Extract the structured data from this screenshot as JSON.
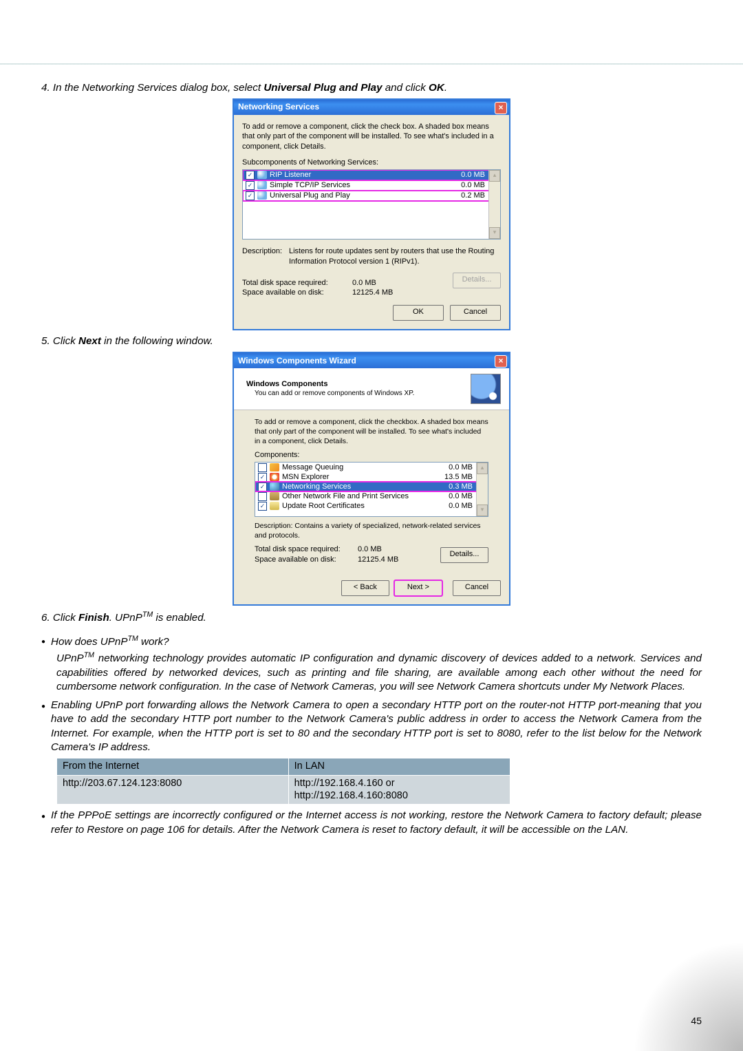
{
  "step4": {
    "text_a": "4. In the Networking Services dialog box, select ",
    "bold": "Universal Plug and Play",
    "text_b": " and click ",
    "bold2": "OK",
    "text_c": "."
  },
  "dialog1": {
    "title": "Networking Services",
    "intro": "To add or remove a component, click the check box. A shaded box means that only part of the component will be installed. To see what's included in a component, click Details.",
    "sub_label": "Subcomponents of Networking Services:",
    "rows": [
      {
        "label": "RIP Listener",
        "size": "0.0 MB",
        "checked": true,
        "selected": true
      },
      {
        "label": "Simple TCP/IP Services",
        "size": "0.0 MB",
        "checked": true,
        "selected": false
      },
      {
        "label": "Universal Plug and Play",
        "size": "0.2 MB",
        "checked": true,
        "selected": false,
        "highlight": true
      }
    ],
    "desc_label": "Description:",
    "desc_text": "Listens for route updates sent by routers that use the Routing Information Protocol version 1 (RIPv1).",
    "req_label": "Total disk space required:",
    "req_val": "0.0 MB",
    "avail_label": "Space available on disk:",
    "avail_val": "12125.4 MB",
    "details_btn": "Details...",
    "ok_btn": "OK",
    "cancel_btn": "Cancel"
  },
  "step5": {
    "text_a": "5. Click ",
    "bold": "Next",
    "text_b": " in the following window."
  },
  "dialog2": {
    "title": "Windows Components Wizard",
    "head_t": "Windows Components",
    "head_s": "You can add or remove components of Windows XP.",
    "intro": "To add or remove a component, click the checkbox. A shaded box means that only part of the component will be installed. To see what's included in a component, click Details.",
    "comp_label": "Components:",
    "rows": [
      {
        "label": "Message Queuing",
        "size": "0.0 MB",
        "checked": false
      },
      {
        "label": "MSN Explorer",
        "size": "13.5 MB",
        "checked": true
      },
      {
        "label": "Networking Services",
        "size": "0.3 MB",
        "checked": true,
        "selected": true
      },
      {
        "label": "Other Network File and Print Services",
        "size": "0.0 MB",
        "checked": false
      },
      {
        "label": "Update Root Certificates",
        "size": "0.0 MB",
        "checked": true
      }
    ],
    "desc": "Description:  Contains a variety of specialized, network-related services and protocols.",
    "req_label": "Total disk space required:",
    "req_val": "0.0 MB",
    "avail_label": "Space available on disk:",
    "avail_val": "12125.4 MB",
    "details_btn": "Details...",
    "back_btn": "< Back",
    "next_btn": "Next >",
    "cancel_btn": "Cancel"
  },
  "step6": {
    "text_a": "6. Click ",
    "bold": "Finish",
    "text_b": ". UPnP",
    "sup": "TM",
    "text_c": " is enabled."
  },
  "q1": {
    "lead": "How does UPnP",
    "sup": "TM",
    "tail": " work?",
    "body_a": "UPnP",
    "body_b": " networking technology provides automatic IP configuration and dynamic discovery of devices added to a network. Services and capabilities offered by networked devices, such as printing and file sharing, are available among each other without the need for cumbersome network configuration. In the case of Network Cameras, you will see Network Camera shortcuts under My Network Places."
  },
  "p2": "Enabling UPnP port forwarding allows the Network Camera to open a secondary HTTP port on the router-not HTTP port-meaning that you have to add the secondary HTTP port number to the Network Camera's public address in order to access the Network Camera from the Internet. For example, when the HTTP port is set to 80 and the secondary HTTP port is set to 8080, refer to the list below for the Network Camera's IP address.",
  "iptable": {
    "h1": "From the Internet",
    "h2": "In LAN",
    "c1": "http://203.67.124.123:8080",
    "c2a": "http://192.168.4.160 or",
    "c2b": "http://192.168.4.160:8080"
  },
  "p3": "If the PPPoE settings are incorrectly configured or the Internet access is not working, restore the Network Camera to factory default; please refer to Restore on page 106 for details. After the Network Camera is reset to factory default, it will be accessible on the LAN.",
  "page_no": "45"
}
